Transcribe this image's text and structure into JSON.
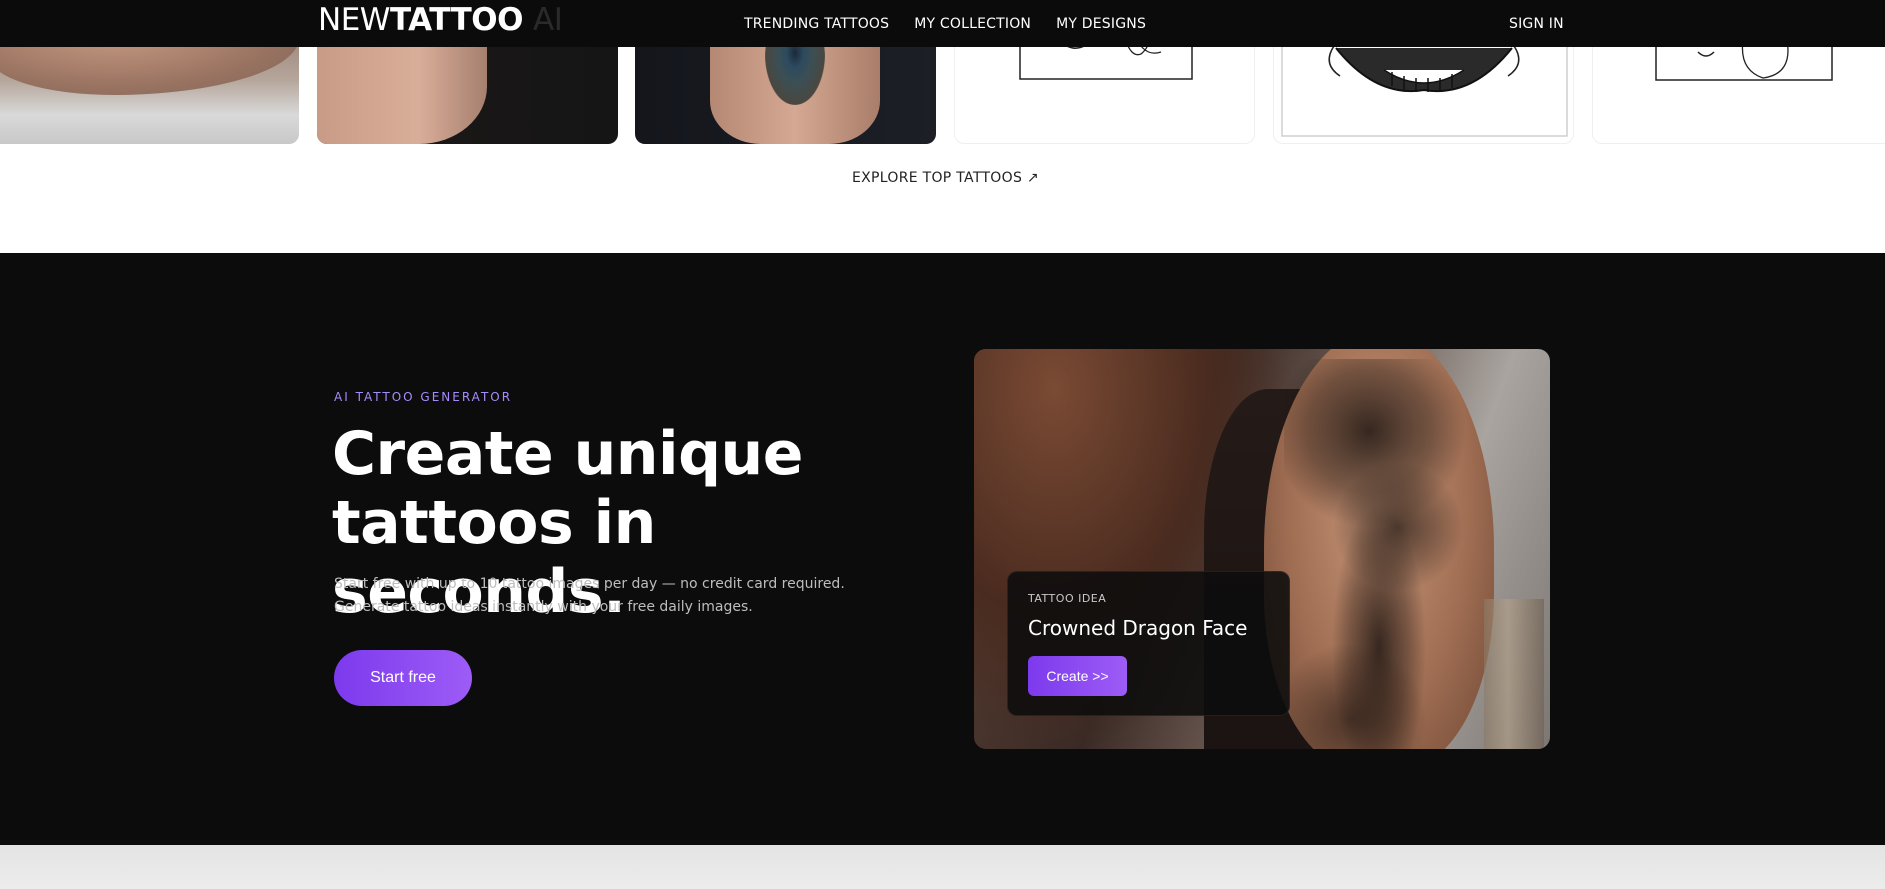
{
  "brand": {
    "name_light": "NEW",
    "name_bold": "TATTOO",
    "name_suffix": "AI"
  },
  "nav": {
    "items": [
      "TRENDING TATTOOS",
      "MY COLLECTION",
      "MY DESIGNS"
    ],
    "sign_in": "SIGN IN"
  },
  "gallery": {
    "explore_link": "EXPLORE TOP TATTOOS ↗"
  },
  "hero": {
    "kicker": "AI TATTOO GENERATOR",
    "headline_line1": "Create unique",
    "headline_line2": "tattoos in seconds.",
    "subcopy_line1": "Start free with up to 10 tattoo images per day — no credit card required.",
    "subcopy_line2": "Generate tattoo ideas instantly with your free daily images.",
    "cta": "Start free",
    "idea_card": {
      "label": "TATTOO IDEA",
      "title": "Crowned Dragon Face",
      "button": "Create >>"
    }
  },
  "colors": {
    "nav_bg": "#0b0b0b",
    "hero_bg": "#0c0c0d",
    "accent": "#7c3aed",
    "accent_light": "#a78bfa"
  }
}
